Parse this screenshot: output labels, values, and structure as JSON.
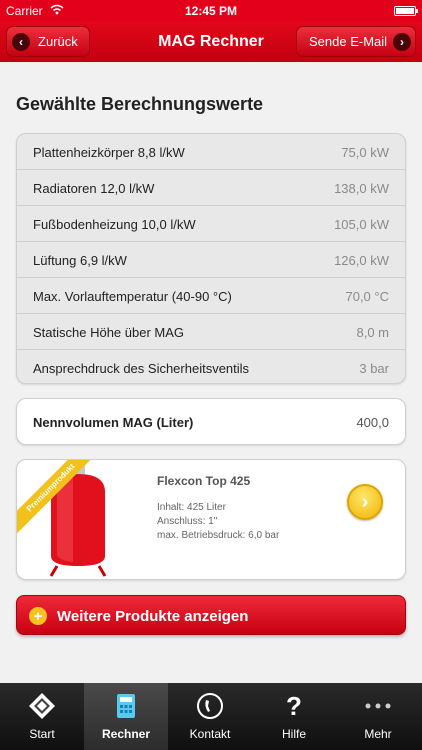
{
  "status": {
    "carrier": "Carrier",
    "time": "12:45 PM"
  },
  "nav": {
    "back_label": "Zurück",
    "title": "MAG Rechner",
    "email_label": "Sende E-Mail"
  },
  "heading": "Gewählte Berechnungswerte",
  "values": [
    {
      "label": "Plattenheizkörper 8,8 l/kW",
      "value": "75,0 kW"
    },
    {
      "label": "Radiatoren 12,0 l/kW",
      "value": "138,0 kW"
    },
    {
      "label": "Fußbodenheizung 10,0 l/kW",
      "value": "105,0 kW"
    },
    {
      "label": "Lüftung 6,9 l/kW",
      "value": "126,0 kW"
    },
    {
      "label": "Max. Vorlauftemperatur (40-90 °C)",
      "value": "70,0 °C"
    },
    {
      "label": "Statische Höhe über MAG",
      "value": "8,0 m"
    },
    {
      "label": "Ansprechdruck des Sicherheitsventils",
      "value": "3 bar"
    }
  ],
  "volume": {
    "label": "Nennvolumen MAG (Liter)",
    "value": "400,0"
  },
  "product": {
    "ribbon": "Premiumprodukt",
    "name": "Flexcon Top 425",
    "inhalt": "Inhalt: 425 Liter",
    "anschluss": "Anschluss: 1\"",
    "druck": "max. Betriebsdruck: 6,0 bar"
  },
  "more_button": "Weitere Produkte anzeigen",
  "tabs": [
    {
      "label": "Start",
      "icon": "start-logo-icon"
    },
    {
      "label": "Rechner",
      "icon": "calculator-icon",
      "active": true
    },
    {
      "label": "Kontakt",
      "icon": "phone-icon"
    },
    {
      "label": "Hilfe",
      "icon": "help-icon"
    },
    {
      "label": "Mehr",
      "icon": "more-dots-icon"
    }
  ],
  "colors": {
    "brand_red": "#e3001b",
    "accent_yellow": "#f2c21b",
    "tabbar": "#1a1a1a"
  }
}
